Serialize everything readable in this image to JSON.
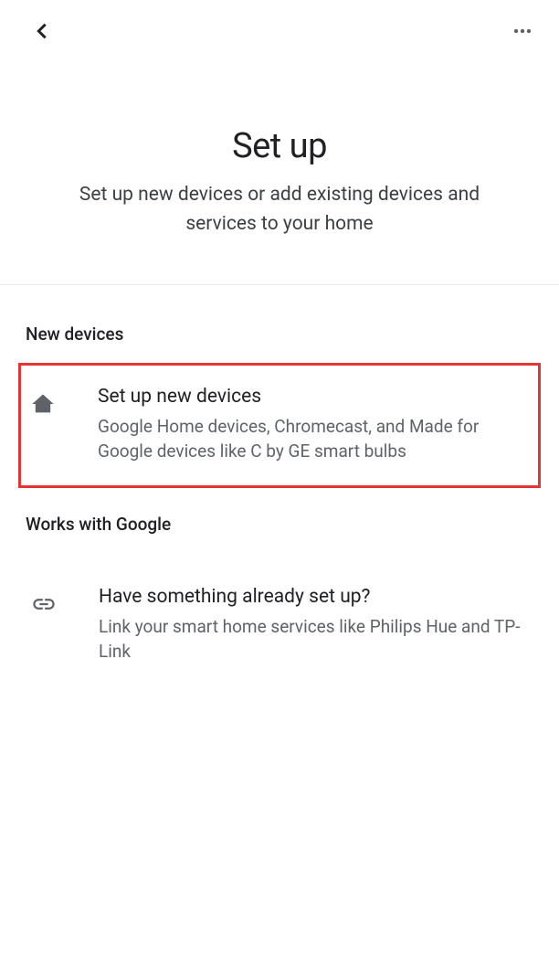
{
  "page": {
    "title": "Set up",
    "subtitle": "Set up new devices or add existing devices and services to your home"
  },
  "sections": {
    "new_devices": {
      "header": "New devices",
      "item": {
        "title": "Set up new devices",
        "desc": "Google Home devices, Chromecast, and Made for Google devices like C by GE smart bulbs"
      }
    },
    "works_with_google": {
      "header": "Works with Google",
      "item": {
        "title": "Have something already set up?",
        "desc": "Link your smart home services like Philips Hue and TP-Link"
      }
    }
  }
}
